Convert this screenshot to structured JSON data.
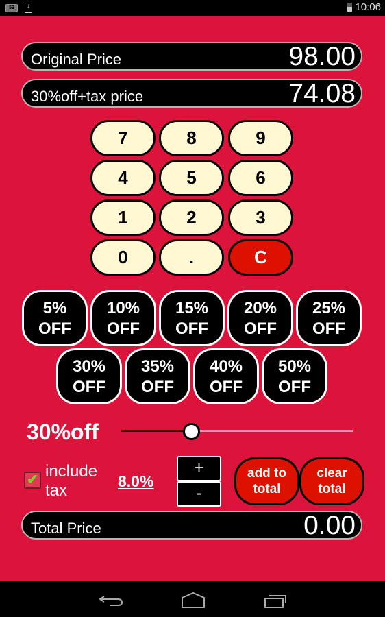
{
  "status_bar": {
    "notification_count": "53",
    "notification_icons": [
      "notification-count-icon",
      "download-icon"
    ],
    "battery_icon": "battery-icon",
    "time": "10:06"
  },
  "app": {
    "background_color": "#dc143c",
    "original_price": {
      "label": "Original Price",
      "value": "98.00"
    },
    "discounted_price": {
      "label": "30%off+tax price",
      "value": "74.08"
    },
    "keypad": [
      "7",
      "8",
      "9",
      "4",
      "5",
      "6",
      "1",
      "2",
      "3",
      "0",
      ".",
      "C"
    ],
    "discount_buttons": [
      {
        "percent": "5%",
        "suffix": "OFF"
      },
      {
        "percent": "10%",
        "suffix": "OFF"
      },
      {
        "percent": "15%",
        "suffix": "OFF"
      },
      {
        "percent": "20%",
        "suffix": "OFF"
      },
      {
        "percent": "25%",
        "suffix": "OFF"
      },
      {
        "percent": "30%",
        "suffix": "OFF"
      },
      {
        "percent": "35%",
        "suffix": "OFF"
      },
      {
        "percent": "40%",
        "suffix": "OFF"
      },
      {
        "percent": "50%",
        "suffix": "OFF"
      }
    ],
    "discount_label": "30%off",
    "discount_slider": {
      "value_percent": 30,
      "min": 0,
      "max": 100
    },
    "include_tax": {
      "checked": true,
      "label_line1": "include",
      "label_line2": "tax",
      "check_glyph": "✔"
    },
    "tax_rate": "8.0%",
    "tax_increment_label": "+",
    "tax_decrement_label": "-",
    "add_to_total": {
      "line1": "add to",
      "line2": "total"
    },
    "clear_total": {
      "line1": "clear",
      "line2": "total"
    },
    "total_price": {
      "label": "Total Price",
      "value": "0.00"
    }
  },
  "nav_bar": {
    "buttons": [
      "back-icon",
      "home-icon",
      "recent-apps-icon"
    ]
  }
}
